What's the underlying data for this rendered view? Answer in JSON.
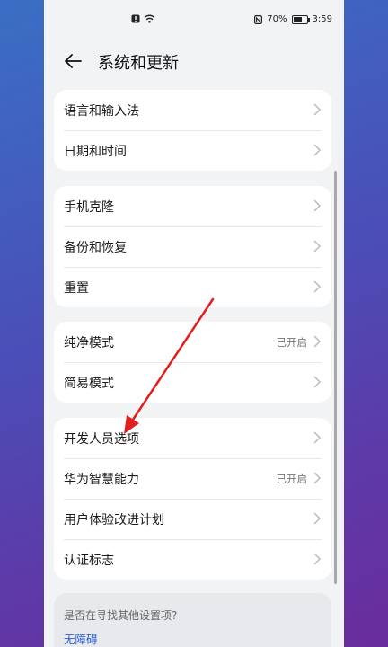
{
  "status_bar": {
    "alert_icon": "alert-icon",
    "wifi_icon": "wifi-icon",
    "nfc_icon": "nfc-icon",
    "battery_percent": "70%",
    "battery_icon": "battery-icon",
    "time": "3:59"
  },
  "header": {
    "back_icon": "back-arrow-icon",
    "title": "系统和更新"
  },
  "groups": [
    {
      "items": [
        {
          "label": "语言和输入法"
        },
        {
          "label": "日期和时间"
        }
      ]
    },
    {
      "items": [
        {
          "label": "手机克隆"
        },
        {
          "label": "备份和恢复"
        },
        {
          "label": "重置"
        }
      ]
    },
    {
      "items": [
        {
          "label": "纯净模式",
          "value": "已开启"
        },
        {
          "label": "简易模式"
        }
      ]
    },
    {
      "items": [
        {
          "label": "开发人员选项"
        },
        {
          "label": "华为智慧能力",
          "value": "已开启"
        },
        {
          "label": "用户体验改进计划"
        },
        {
          "label": "认证标志"
        }
      ]
    }
  ],
  "tip": {
    "text": "是否在寻找其他设置项?",
    "link": "无障碍"
  },
  "colors": {
    "accent_link": "#2a5fd8",
    "annotation_arrow": "#e02020"
  }
}
